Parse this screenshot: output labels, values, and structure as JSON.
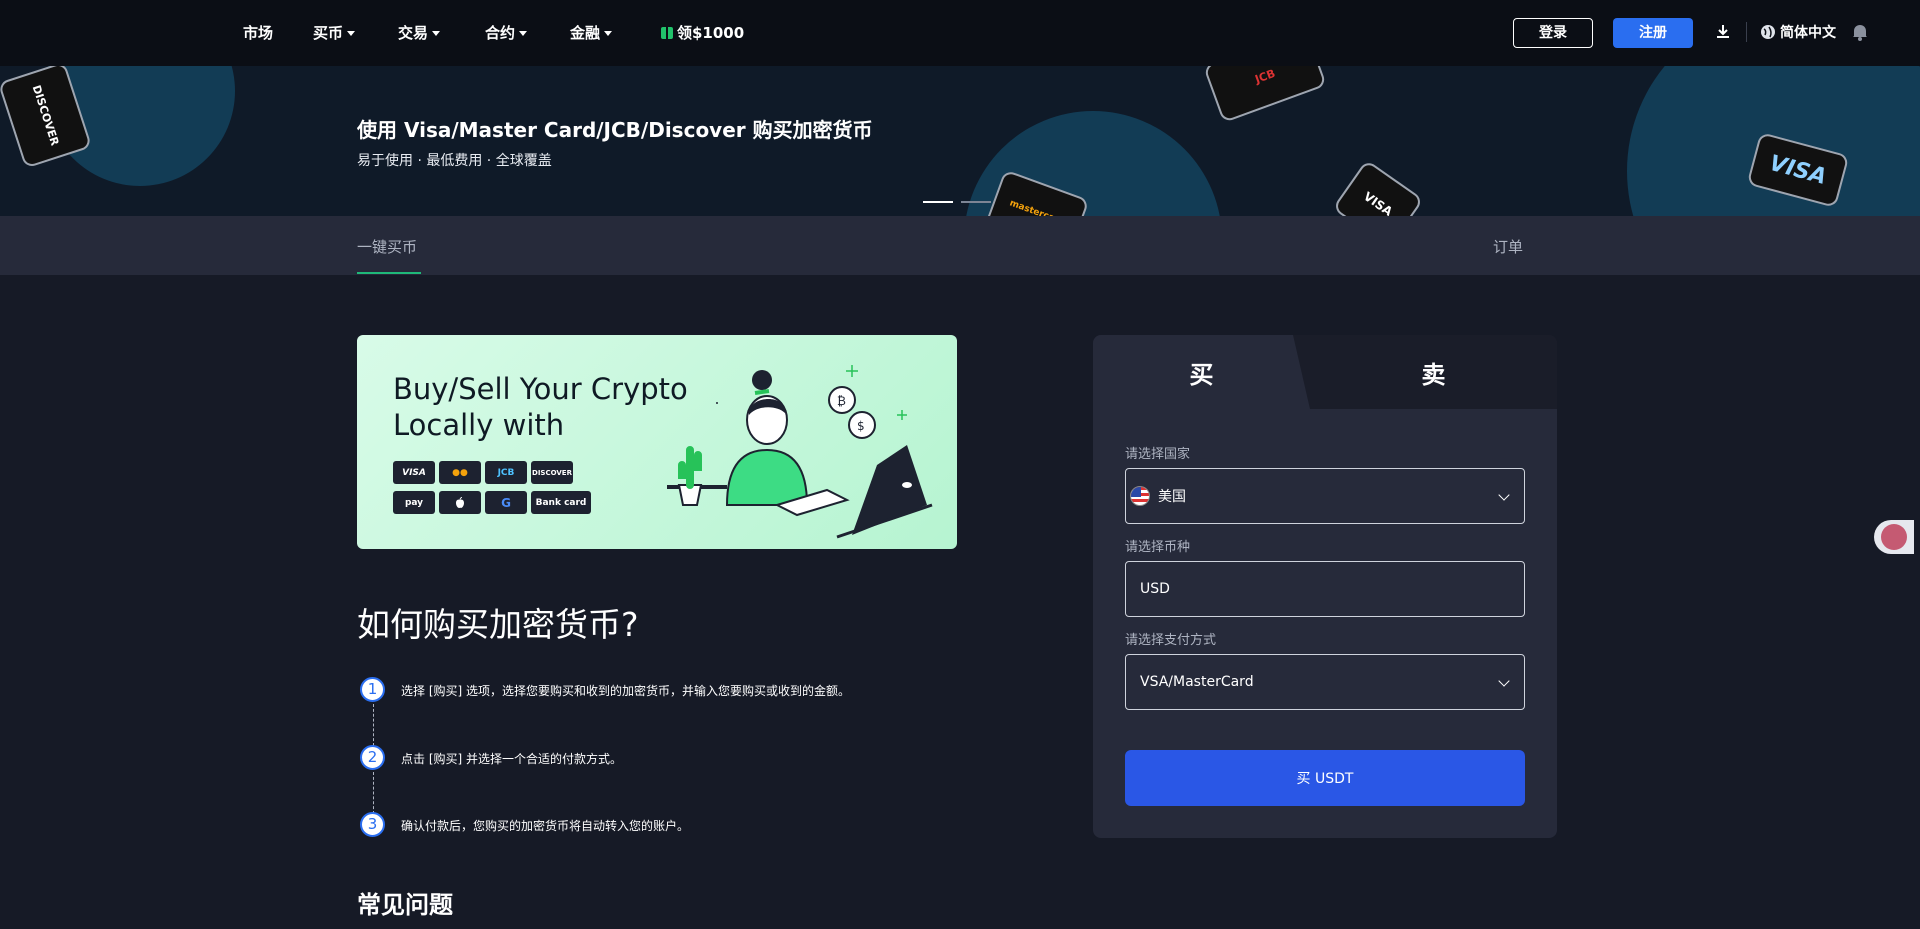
{
  "nav": {
    "items": [
      {
        "label": "市场",
        "dropdown": false
      },
      {
        "label": "买币",
        "dropdown": true
      },
      {
        "label": "交易",
        "dropdown": true
      },
      {
        "label": "合约",
        "dropdown": true
      },
      {
        "label": "金融",
        "dropdown": true
      }
    ],
    "promo_label": "领$1000",
    "login_label": "登录",
    "register_label": "注册",
    "language_label": "简体中文"
  },
  "hero": {
    "title": "使用 Visa/Master Card/JCB/Discover 购买加密货币",
    "subtitle": "易于使用 · 最低费用 · 全球覆盖",
    "cards": [
      "DISCOVER",
      "JCB",
      "mastercard",
      "VISA",
      "VISA"
    ],
    "slides_count": 2,
    "active_slide": 1
  },
  "tabs": {
    "main_label": "一键买币",
    "orders_label": "订单"
  },
  "banner": {
    "title_line1": "Buy/Sell Your Crypto",
    "title_line2": "Locally with",
    "payment_methods": [
      "VISA",
      "●●",
      "JCB",
      "DISCOVER",
      "pay",
      "",
      "G",
      "Bank card"
    ]
  },
  "howto": {
    "title": "如何购买加密货币?",
    "steps": [
      {
        "num": "1",
        "text": "选择 [购买] 选项，选择您要购买和收到的加密货币，并输入您要购买或收到的金额。"
      },
      {
        "num": "2",
        "text": "点击 [购买] 并选择一个合适的付款方式。"
      },
      {
        "num": "3",
        "text": "确认付款后，您购买的加密货币将自动转入您的账户。"
      }
    ]
  },
  "faq": {
    "title": "常见问题"
  },
  "panel": {
    "buy_tab": "买",
    "sell_tab": "卖",
    "country_label": "请选择国家",
    "country_value": "美国",
    "currency_label": "请选择币种",
    "currency_value": "USD",
    "payment_label": "请选择支付方式",
    "payment_value": "VSA/MasterCard",
    "buy_button": "买 USDT"
  },
  "colors": {
    "accent": "#2a6ef0",
    "buy_button": "#2a57e6",
    "tab_underline": "#1fb979",
    "background": "#161a26"
  }
}
